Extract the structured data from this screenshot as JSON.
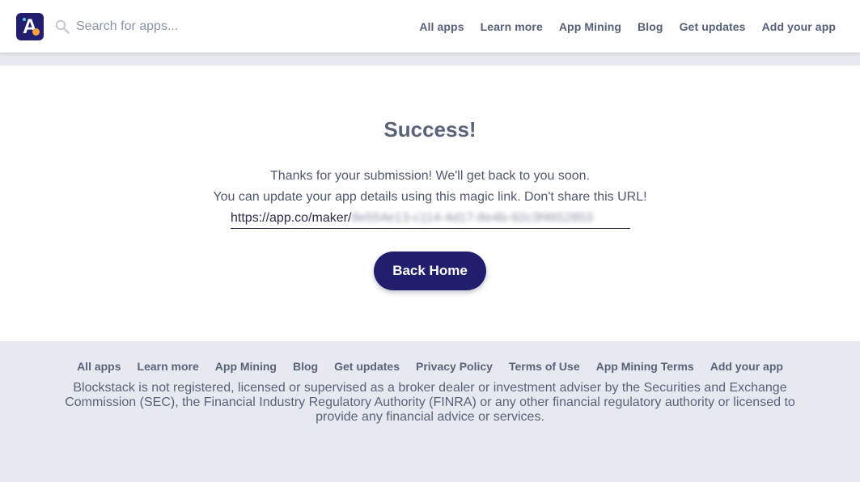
{
  "header": {
    "logo_letter": "A",
    "search": {
      "placeholder": "Search for apps...",
      "value": ""
    },
    "nav": [
      {
        "label": "All apps"
      },
      {
        "label": "Learn more"
      },
      {
        "label": "App Mining"
      },
      {
        "label": "Blog"
      },
      {
        "label": "Get updates"
      },
      {
        "label": "Add your app"
      }
    ]
  },
  "main": {
    "title": "Success!",
    "message_line1": "Thanks for your submission! We'll get back to you soon.",
    "message_line2": "You can update your app details using this magic link. Don't share this URL!",
    "magic_link": {
      "visible_prefix": "https://app.co/maker/",
      "obscured_part": "8e554e13-c114-4d17-8e4b-92c3f4652853"
    },
    "back_button_label": "Back Home"
  },
  "footer": {
    "nav": [
      {
        "label": "All apps"
      },
      {
        "label": "Learn more"
      },
      {
        "label": "App Mining"
      },
      {
        "label": "Blog"
      },
      {
        "label": "Get updates"
      },
      {
        "label": "Privacy Policy"
      },
      {
        "label": "Terms of Use"
      },
      {
        "label": "App Mining Terms"
      },
      {
        "label": "Add your app"
      }
    ],
    "disclaimer": "Blockstack is not registered, licensed or supervised as a broker dealer or investment adviser by the Securities and Exchange Commission (SEC), the Financial Industry Regulatory Authority (FINRA) or any other financial regulatory authority or licensed to provide any financial advice or services."
  },
  "colors": {
    "brand": "#211f6d",
    "logo_dot": "#f7a23c",
    "text_muted": "#5a6379",
    "page_background": "#e6e9ef"
  }
}
